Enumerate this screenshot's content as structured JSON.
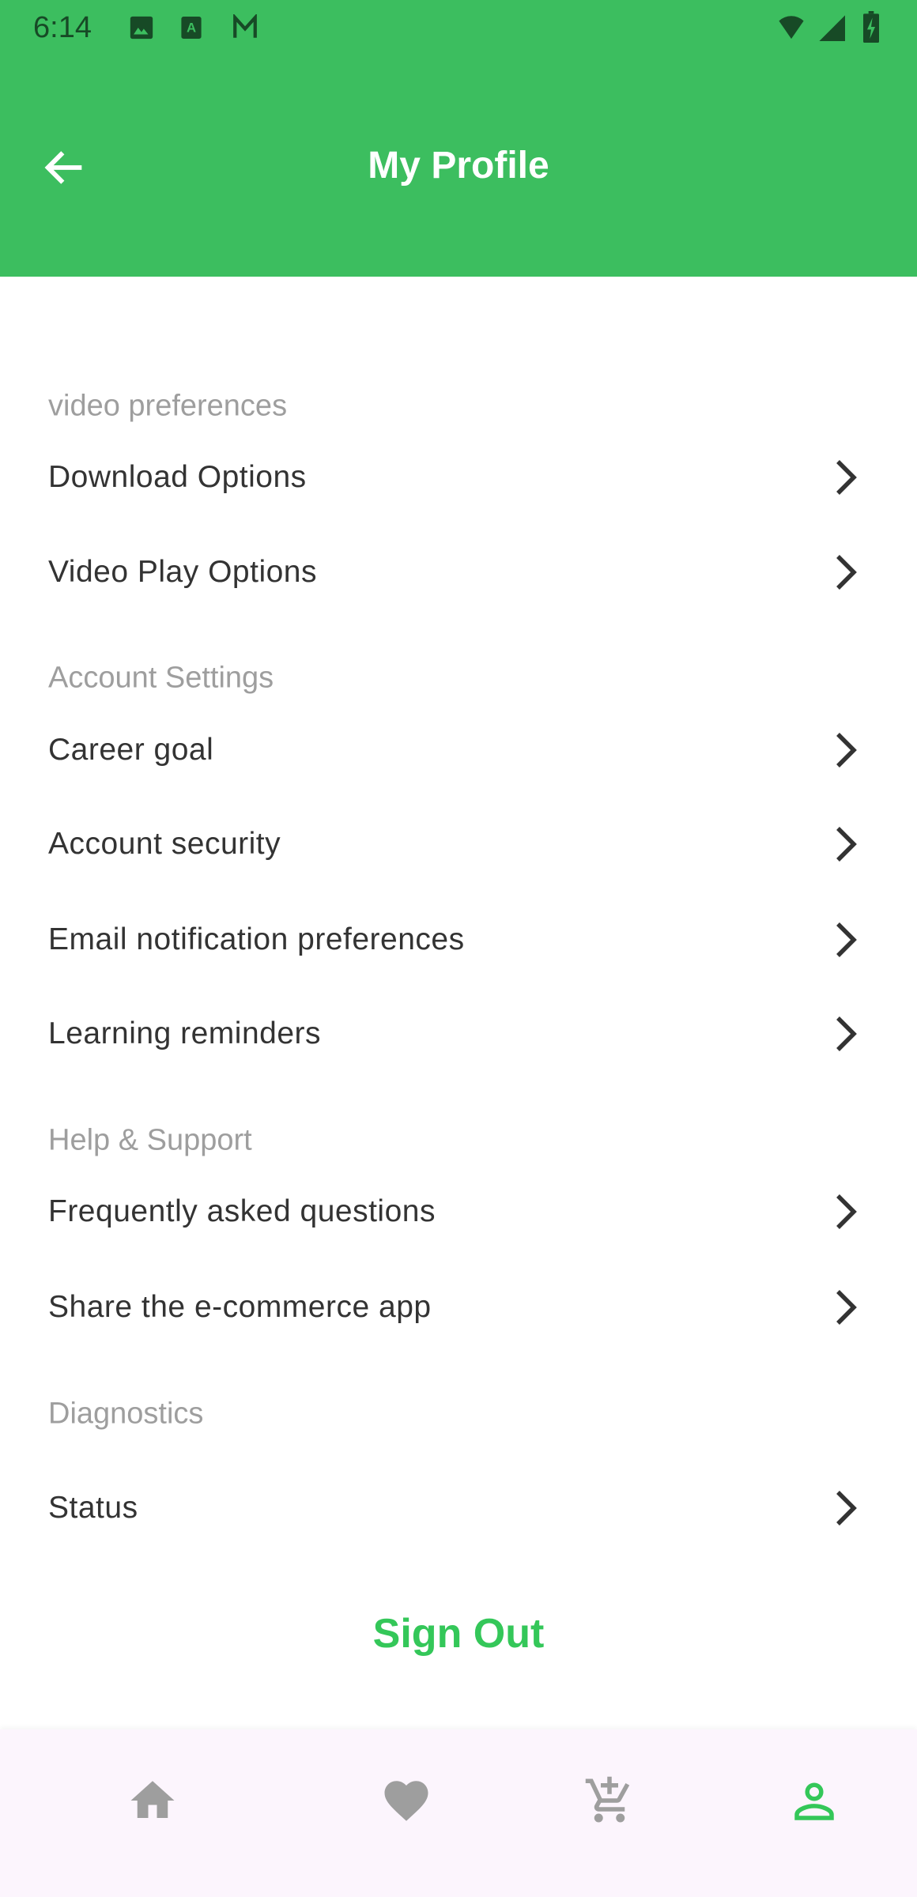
{
  "status_bar": {
    "time": "6:14",
    "icons": [
      "image-icon",
      "font-download-icon",
      "gmail-icon",
      "wifi-icon",
      "signal-icon",
      "battery-charging-icon"
    ]
  },
  "header": {
    "title": "My Profile",
    "back_icon": "arrow-back-icon"
  },
  "sections": [
    {
      "title": "video preferences",
      "items": [
        {
          "label": "Download Options"
        },
        {
          "label": "Video Play Options"
        }
      ]
    },
    {
      "title": "Account Settings",
      "items": [
        {
          "label": "Career goal"
        },
        {
          "label": "Account security"
        },
        {
          "label": "Email notification preferences"
        },
        {
          "label": "Learning reminders"
        }
      ]
    },
    {
      "title": "Help & Support",
      "items": [
        {
          "label": "Frequently asked questions"
        },
        {
          "label": "Share the e-commerce app"
        }
      ]
    },
    {
      "title": "Diagnostics",
      "items": [
        {
          "label": "Status"
        }
      ]
    }
  ],
  "sign_out": "Sign Out",
  "bottom_nav": {
    "items": [
      "home-icon",
      "favorite-icon",
      "add-to-cart-icon",
      "person-icon"
    ],
    "active": "person-icon"
  },
  "colors": {
    "primary": "#3cbe5f",
    "accent": "#34c759",
    "muted": "#9e9e9e",
    "inactive_icon": "#9e9e9e"
  }
}
